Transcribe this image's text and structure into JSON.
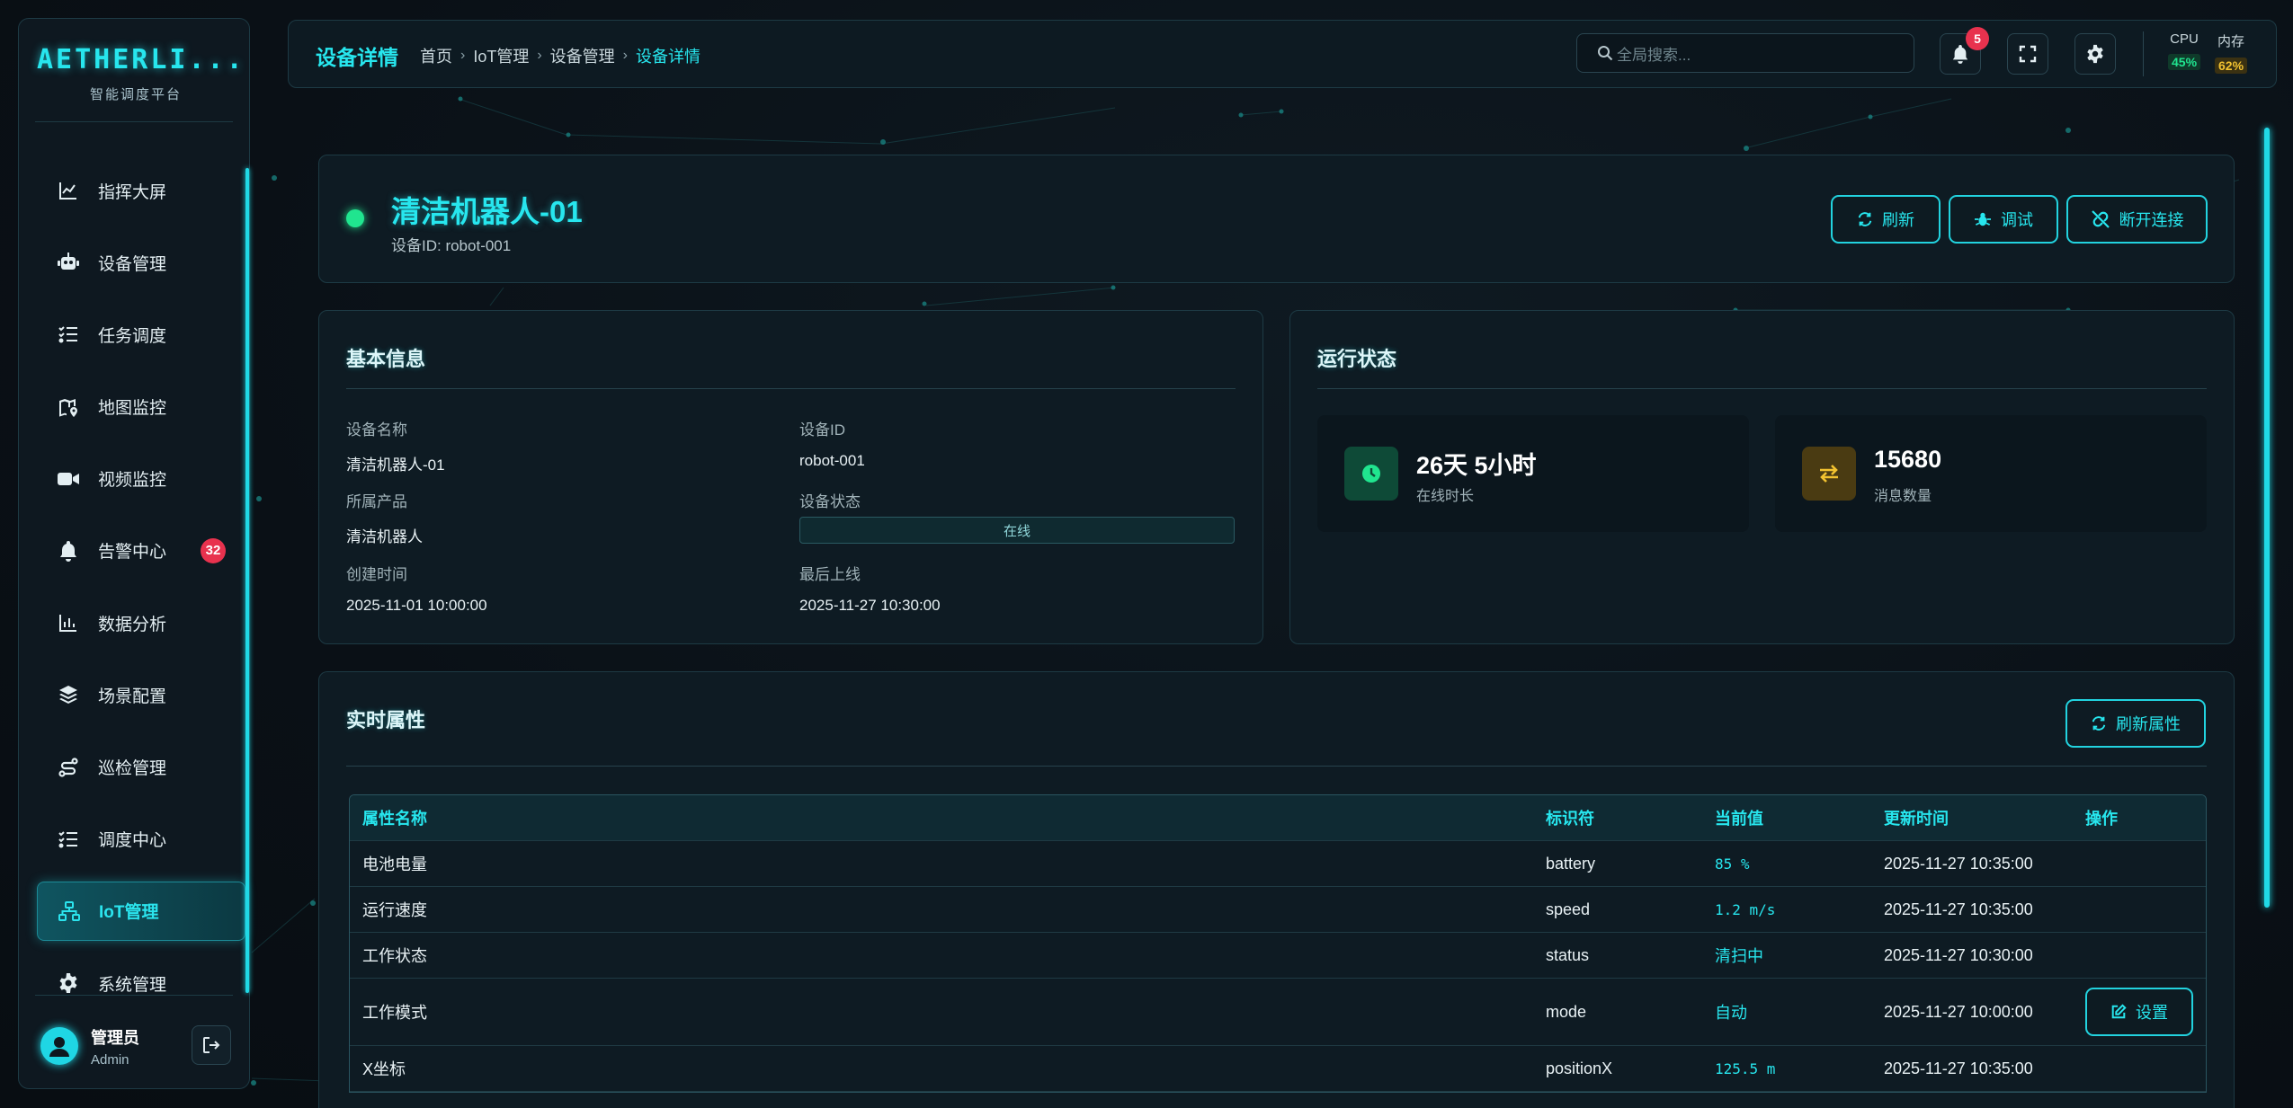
{
  "brand": {
    "logo": "AETHERLI...",
    "subtitle": "智能调度平台"
  },
  "sidebar": {
    "items": [
      {
        "label": "指挥大屏",
        "icon": "chart-line-icon"
      },
      {
        "label": "设备管理",
        "icon": "robot-icon"
      },
      {
        "label": "任务调度",
        "icon": "task-list-icon"
      },
      {
        "label": "地图监控",
        "icon": "map-pin-icon"
      },
      {
        "label": "视频监控",
        "icon": "video-camera-icon"
      },
      {
        "label": "告警中心",
        "icon": "bell-icon",
        "badge": "32"
      },
      {
        "label": "数据分析",
        "icon": "bar-chart-icon"
      },
      {
        "label": "场景配置",
        "icon": "layers-icon"
      },
      {
        "label": "巡检管理",
        "icon": "route-icon"
      },
      {
        "label": "调度中心",
        "icon": "task-list-icon"
      },
      {
        "label": "IoT管理",
        "icon": "network-icon",
        "active": true
      },
      {
        "label": "系统管理",
        "icon": "gear-icon"
      }
    ],
    "user": {
      "name": "管理员",
      "role": "Admin"
    }
  },
  "header": {
    "title": "设备详情",
    "breadcrumb": [
      "首页",
      "IoT管理",
      "设备管理",
      "设备详情"
    ],
    "search_placeholder": "全局搜索...",
    "notification_count": "5",
    "cpu_label": "CPU",
    "cpu_value": "45%",
    "mem_label": "内存",
    "mem_value": "62%"
  },
  "device": {
    "name": "清洁机器人-01",
    "id_text": "设备ID: robot-001",
    "actions": {
      "refresh": "刷新",
      "debug": "调试",
      "disconnect": "断开连接"
    }
  },
  "basic_info": {
    "title": "基本信息",
    "fields": {
      "name_label": "设备名称",
      "name_value": "清洁机器人-01",
      "id_label": "设备ID",
      "id_value": "robot-001",
      "product_label": "所属产品",
      "product_value": "清洁机器人",
      "status_label": "设备状态",
      "status_value": "在线",
      "created_label": "创建时间",
      "created_value": "2025-11-01 10:00:00",
      "last_label": "最后上线",
      "last_value": "2025-11-27 10:30:00"
    }
  },
  "run_status": {
    "title": "运行状态",
    "online_value": "26天 5小时",
    "online_label": "在线时长",
    "msg_value": "15680",
    "msg_label": "消息数量"
  },
  "realtime": {
    "title": "实时属性",
    "refresh_label": "刷新属性",
    "columns": [
      "属性名称",
      "标识符",
      "当前值",
      "更新时间",
      "操作"
    ],
    "rows": [
      {
        "name": "电池电量",
        "id": "battery",
        "value": "85 %",
        "time": "2025-11-27 10:35:00",
        "mono": true
      },
      {
        "name": "运行速度",
        "id": "speed",
        "value": "1.2 m/s",
        "time": "2025-11-27 10:35:00",
        "mono": true
      },
      {
        "name": "工作状态",
        "id": "status",
        "value": "清扫中",
        "time": "2025-11-27 10:30:00",
        "mono": false
      },
      {
        "name": "工作模式",
        "id": "mode",
        "value": "自动",
        "time": "2025-11-27 10:00:00",
        "mono": false,
        "action": "设置",
        "overflow": "..."
      },
      {
        "name": "X坐标",
        "id": "positionX",
        "value": "125.5 m",
        "time": "2025-11-27 10:35:00",
        "mono": true
      }
    ]
  },
  "colors": {
    "accent": "#27e6ee",
    "online": "#20e58f",
    "danger": "#e8324e",
    "cpu": "#20e58f",
    "mem": "#f2c230"
  }
}
